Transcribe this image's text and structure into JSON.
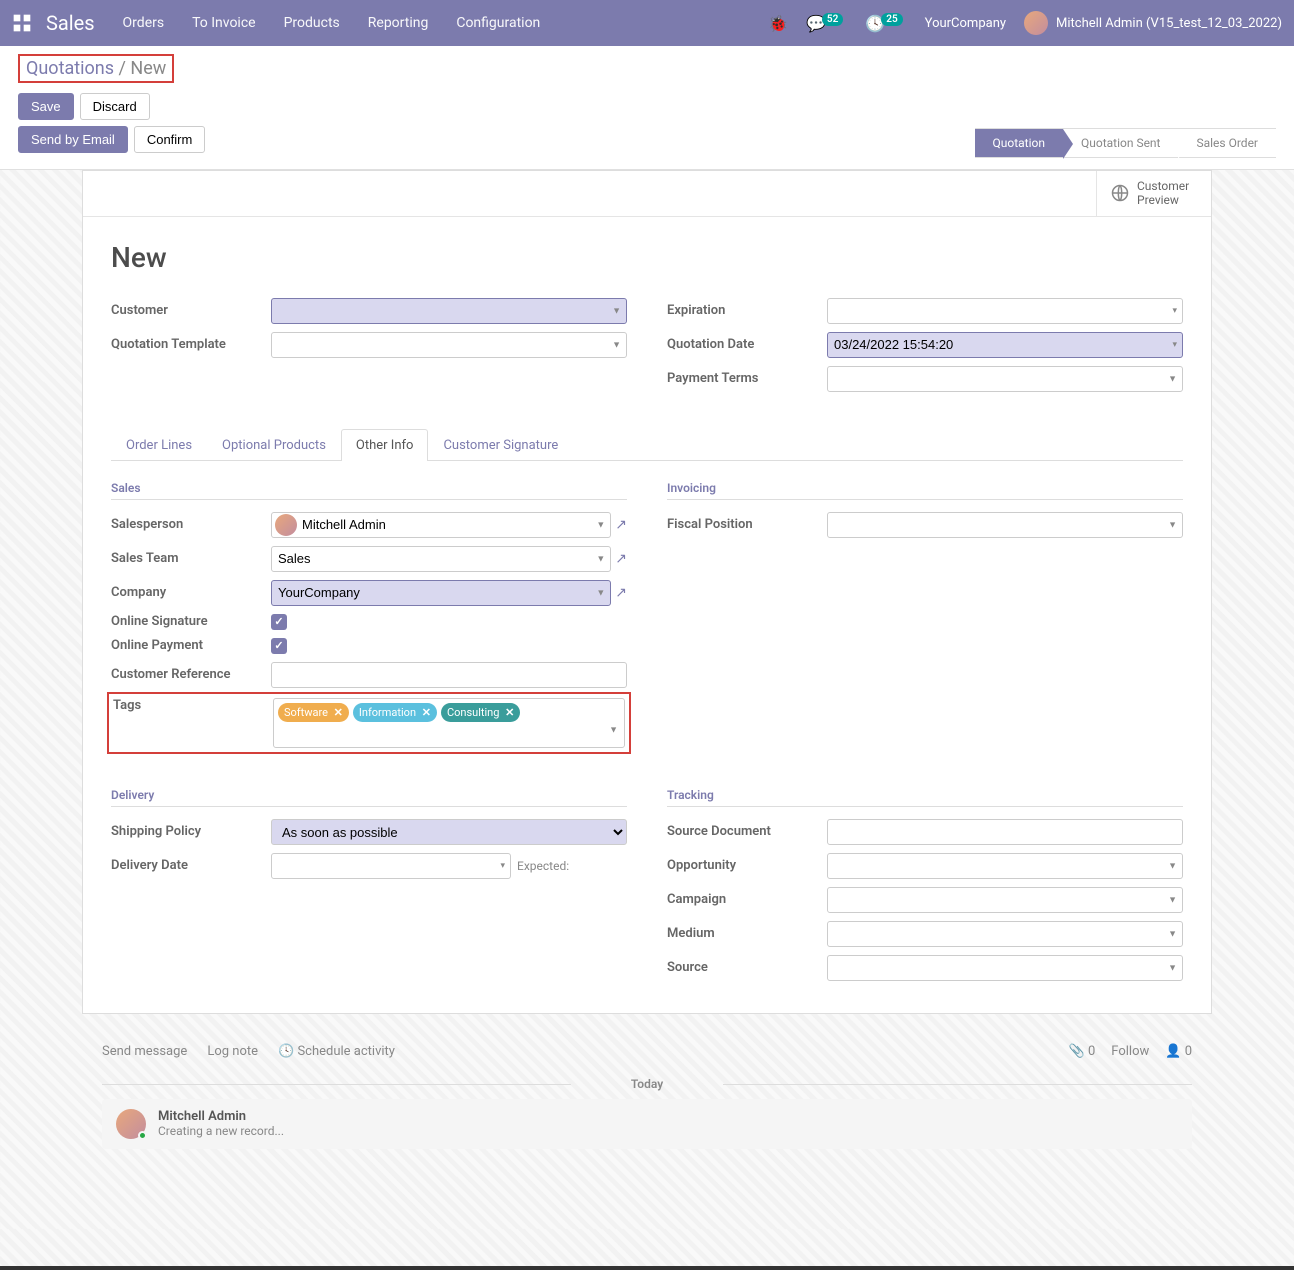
{
  "navbar": {
    "brand": "Sales",
    "links": [
      "Orders",
      "To Invoice",
      "Products",
      "Reporting",
      "Configuration"
    ],
    "msg_badge": "52",
    "activity_badge": "25",
    "company": "YourCompany",
    "user": "Mitchell Admin (V15_test_12_03_2022)"
  },
  "breadcrumb": {
    "parent": "Quotations",
    "current": "New"
  },
  "buttons": {
    "save": "Save",
    "discard": "Discard",
    "send_email": "Send by Email",
    "confirm": "Confirm"
  },
  "status": [
    "Quotation",
    "Quotation Sent",
    "Sales Order"
  ],
  "sheet": {
    "customer_preview": "Customer Preview",
    "title": "New",
    "labels": {
      "customer": "Customer",
      "quotation_template": "Quotation Template",
      "expiration": "Expiration",
      "quotation_date": "Quotation Date",
      "payment_terms": "Payment Terms"
    },
    "values": {
      "quotation_date": "03/24/2022 15:54:20"
    }
  },
  "tabs": [
    "Order Lines",
    "Optional Products",
    "Other Info",
    "Customer Signature"
  ],
  "other_info": {
    "sections": {
      "sales": "Sales",
      "invoicing": "Invoicing",
      "delivery": "Delivery",
      "tracking": "Tracking"
    },
    "labels": {
      "salesperson": "Salesperson",
      "sales_team": "Sales Team",
      "company": "Company",
      "online_signature": "Online Signature",
      "online_payment": "Online Payment",
      "customer_reference": "Customer Reference",
      "tags": "Tags",
      "fiscal_position": "Fiscal Position",
      "shipping_policy": "Shipping Policy",
      "delivery_date": "Delivery Date",
      "expected": "Expected:",
      "source_document": "Source Document",
      "opportunity": "Opportunity",
      "campaign": "Campaign",
      "medium": "Medium",
      "source": "Source"
    },
    "values": {
      "salesperson": "Mitchell Admin",
      "sales_team": "Sales",
      "company": "YourCompany",
      "shipping_policy": "As soon as possible"
    },
    "tags": [
      {
        "label": "Software",
        "color": "orange"
      },
      {
        "label": "Information",
        "color": "blue"
      },
      {
        "label": "Consulting",
        "color": "teal"
      }
    ]
  },
  "chatter": {
    "send_message": "Send message",
    "log_note": "Log note",
    "schedule_activity": "Schedule activity",
    "attach_count": "0",
    "follow": "Follow",
    "follower_count": "0",
    "today": "Today",
    "msg_author": "Mitchell Admin",
    "msg_body": "Creating a new record..."
  }
}
